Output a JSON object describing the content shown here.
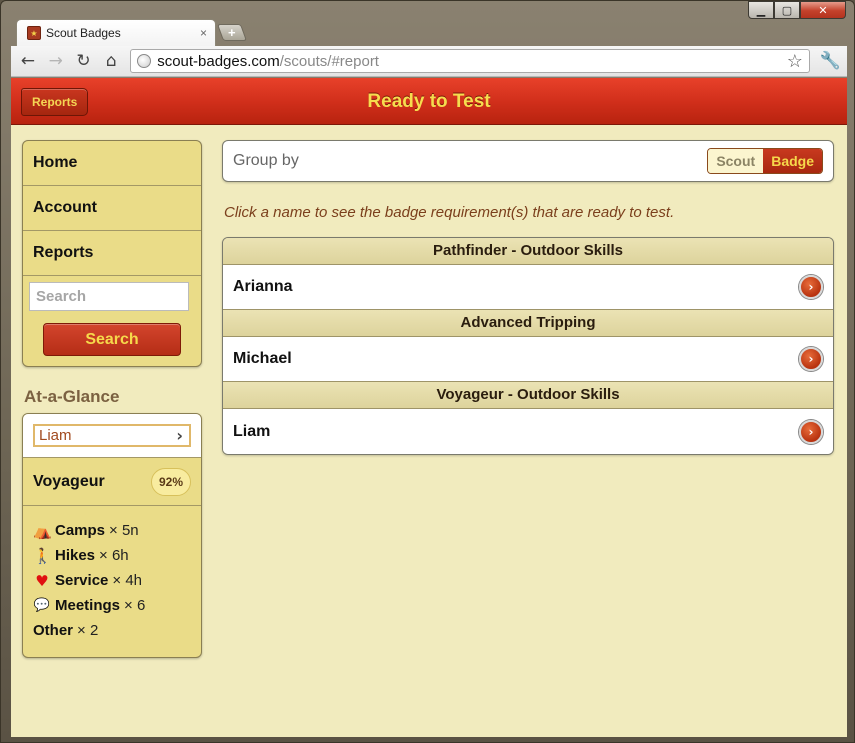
{
  "browser": {
    "tab_title": "Scout Badges",
    "tab_close": "×",
    "new_tab": "+",
    "url_host": "scout-badges.com",
    "url_path": "/scouts/#report"
  },
  "header": {
    "back_label": "Reports",
    "title": "Ready to Test"
  },
  "sidebar": {
    "items": [
      {
        "label": "Home"
      },
      {
        "label": "Account"
      },
      {
        "label": "Reports"
      }
    ],
    "search_placeholder": "Search",
    "search_button": "Search"
  },
  "glance": {
    "heading": "At-a-Glance",
    "scout": "Liam",
    "rank": "Voyageur",
    "rank_percent": "92%",
    "stats": [
      {
        "icon": "tent-icon",
        "label": "Camps",
        "value": "× 5n"
      },
      {
        "icon": "hiker-icon",
        "label": "Hikes",
        "value": "× 6h"
      },
      {
        "icon": "heart-icon",
        "label": "Service",
        "value": "× 4h"
      },
      {
        "icon": "speech-bubble-icon",
        "label": "Meetings",
        "value": "× 6"
      },
      {
        "icon": "",
        "label": "Other",
        "value": "× 2"
      }
    ]
  },
  "groupby": {
    "label": "Group by",
    "options": [
      "Scout",
      "Badge"
    ],
    "selected": "Badge"
  },
  "instruction": "Click a name to see the badge requirement(s) that are ready to test.",
  "results": [
    {
      "badge": "Pathfinder - Outdoor Skills",
      "scout": "Arianna"
    },
    {
      "badge": "Advanced Tripping",
      "scout": "Michael"
    },
    {
      "badge": "Voyageur - Outdoor Skills",
      "scout": "Liam"
    }
  ],
  "colors": {
    "header_red": "#cf2e1a",
    "title_yellow": "#f6dc4e",
    "content_bg": "#f1ebbe",
    "panel_gold": "#eadc88"
  }
}
